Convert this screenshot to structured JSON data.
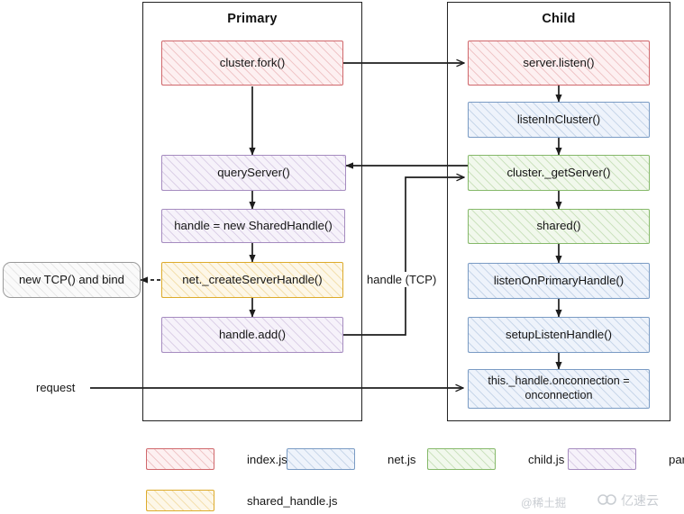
{
  "diagram": {
    "lanes": [
      {
        "id": "primary",
        "title": "Primary"
      },
      {
        "id": "child",
        "title": "Child"
      }
    ],
    "primary_nodes": [
      {
        "id": "cluster-fork",
        "label": "cluster.fork()",
        "color": "red"
      },
      {
        "id": "query-server",
        "label": "queryServer()",
        "color": "purple"
      },
      {
        "id": "new-shared-handle",
        "label": "handle = new SharedHandle()",
        "color": "purple"
      },
      {
        "id": "create-server-handle",
        "label": "net._createServerHandle()",
        "color": "orange"
      },
      {
        "id": "handle-add",
        "label": "handle.add()",
        "color": "purple"
      }
    ],
    "child_nodes": [
      {
        "id": "server-listen",
        "label": "server.listen()",
        "color": "red"
      },
      {
        "id": "listen-in-cluster",
        "label": "listenInCluster()",
        "color": "blue"
      },
      {
        "id": "cluster-get-server",
        "label": "cluster._getServer()",
        "color": "green"
      },
      {
        "id": "shared",
        "label": "shared()",
        "color": "green"
      },
      {
        "id": "listen-on-primary",
        "label": "listenOnPrimaryHandle()",
        "color": "blue"
      },
      {
        "id": "setup-listen-handle",
        "label": "setupListenHandle()",
        "color": "blue"
      },
      {
        "id": "onconnection",
        "label": "this._handle.onconnection = onconnection",
        "color": "blue"
      }
    ],
    "side_note": {
      "id": "new-tcp-bind",
      "label": "new TCP() and bind"
    },
    "edge_labels": {
      "handle_tcp": "handle (TCP)",
      "request": "request"
    }
  },
  "legend": {
    "items": [
      {
        "id": "index-js",
        "label": "index.js",
        "color": "red"
      },
      {
        "id": "net-js",
        "label": "net.js",
        "color": "blue"
      },
      {
        "id": "child-js",
        "label": "child.js",
        "color": "green"
      },
      {
        "id": "parent-js",
        "label": "parent.js",
        "color": "purple"
      },
      {
        "id": "shared-handle-js",
        "label": "shared_handle.js",
        "color": "orange"
      }
    ]
  },
  "watermarks": {
    "juejin": "@稀土掘",
    "yisuyun": "亿速云"
  },
  "colors": {
    "red": "#d0686c",
    "blue": "#7a9bc4",
    "green": "#86b96a",
    "purple": "#a68cc0",
    "orange": "#ddab2c",
    "stroke": "#222222"
  }
}
